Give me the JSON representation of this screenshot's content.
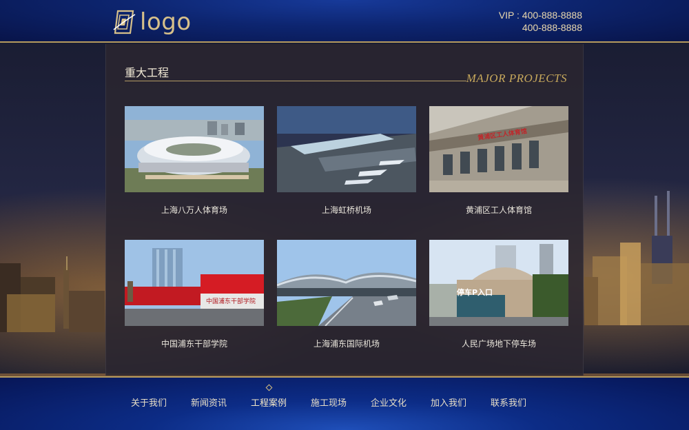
{
  "header": {
    "logo_text": "logo",
    "vip_line1": "VIP : 400-888-8888",
    "vip_line2": "400-888-8888"
  },
  "section": {
    "title": "重大工程",
    "title_en": "MAJOR PROJECTS"
  },
  "projects": [
    {
      "caption": "上海八万人体育场"
    },
    {
      "caption": "上海虹桥机场"
    },
    {
      "caption": "黄浦区工人体育馆"
    },
    {
      "caption": "中国浦东干部学院"
    },
    {
      "caption": "上海浦东国际机场"
    },
    {
      "caption": "人民广场地下停车场"
    }
  ],
  "nav": {
    "items": [
      {
        "label": "关于我们"
      },
      {
        "label": "新闻资讯"
      },
      {
        "label": "工程案例"
      },
      {
        "label": "施工现场"
      },
      {
        "label": "企业文化"
      },
      {
        "label": "加入我们"
      },
      {
        "label": "联系我们"
      }
    ],
    "active_index": 2
  },
  "colors": {
    "gold": "#c8a95c",
    "header_blue": "#0d2570",
    "panel": "#2a2530"
  },
  "photo_signs": {
    "gym_sign": "黄浦区工人体育馆",
    "school_sign": "中国浦东干部学院",
    "parking_sign": "停车P入口"
  }
}
